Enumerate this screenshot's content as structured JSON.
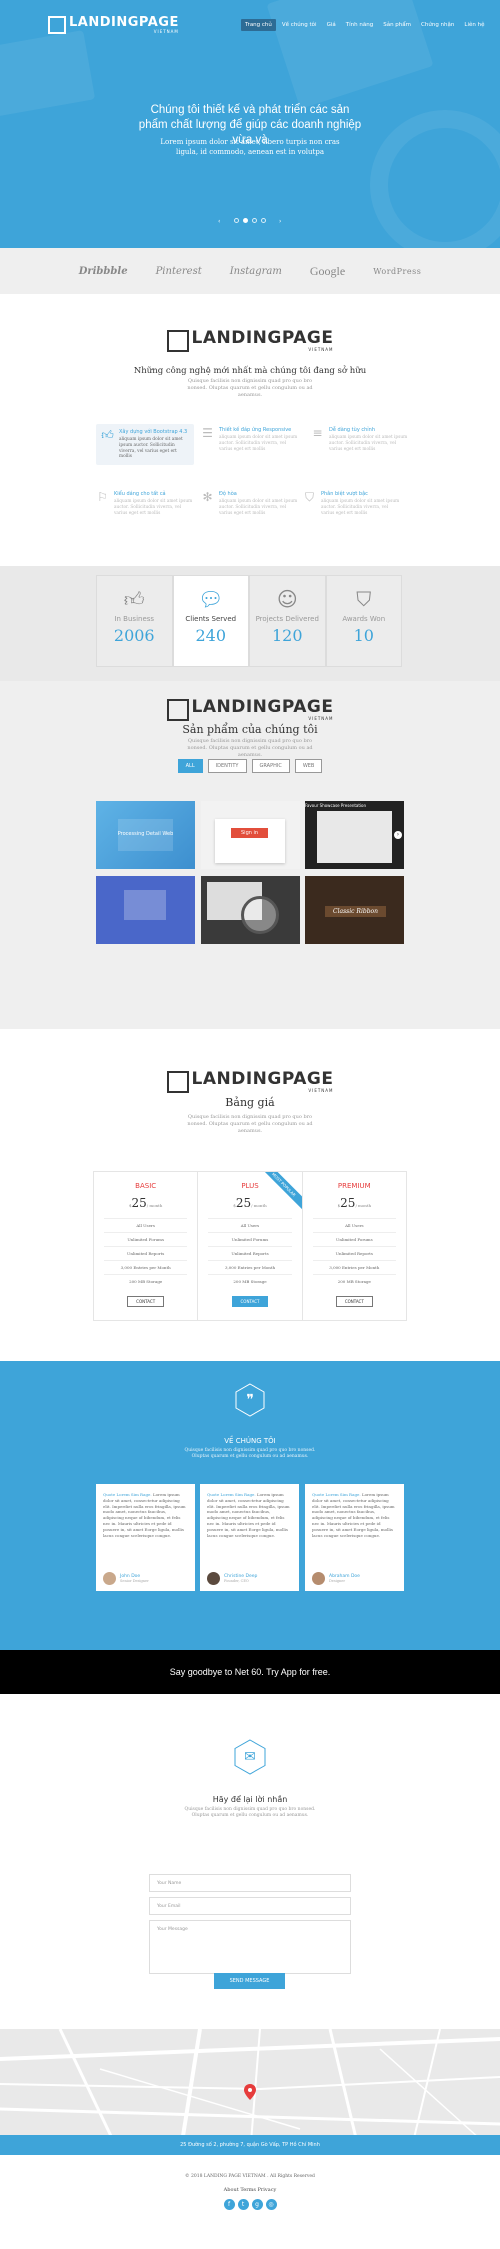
{
  "brand": {
    "name": "LANDINGPAGE",
    "sub": "VIETNAM"
  },
  "nav": {
    "items": [
      "Trang chủ",
      "Về chúng tôi",
      "Giá",
      "Tính năng",
      "Sản phẩm",
      "Chứng nhận",
      "Liên hệ"
    ],
    "active": 0
  },
  "hero": {
    "headline": "Chúng tôi thiết kế và phát triển các sản phẩm chất lượng để giúp các doanh nghiệp vừa và",
    "text": "Lorem ipsum dolor sit amet, libero turpis non cras ligula, id commodo, aenean est in volutpa",
    "slides": 4,
    "active_slide": 1
  },
  "partners": [
    "Dribbble",
    "Pinterest",
    "Instagram",
    "Google",
    "WordPress"
  ],
  "features": {
    "title": "Những công nghệ mới nhất mà chúng tôi đang sở hữu",
    "sub": "Quisque facilisis non dignissim quad pro quo bro nonsed. Oluptas quarum et gellu congulum ou ad aenamus.",
    "items": [
      {
        "icon": "thumbs-up-icon",
        "title": "Xây dựng với Bootstrap 4.3",
        "text": "aliquam ipsum dolor sit amet ipsum auctor. Sollicitudin viverra, vel varius eget ert mollis"
      },
      {
        "icon": "list-icon",
        "title": "Thiết kế đáp ứng Responsive",
        "text": "aliquam ipsum dolor sit amet ipsum auctor. Sollicitudin viverra, vel varius eget ert mollis"
      },
      {
        "icon": "lines-icon",
        "title": "Dễ dàng tùy chỉnh",
        "text": "aliquam ipsum dolor sit amet ipsum auctor. Sollicitudin viverra, vel varius eget ert mollis"
      },
      {
        "icon": "flag-icon",
        "title": "Kiểu dáng cho tất cả",
        "text": "aliquam ipsum dolor sit amet ipsum auctor. Sollicitudin viverra, vel varius eget ert mollis"
      },
      {
        "icon": "snowflake-icon",
        "title": "Độ hòa",
        "text": "aliquam ipsum dolor sit amet ipsum auctor. Sollicitudin viverra, vel varius eget ert mollis"
      },
      {
        "icon": "bookmark-icon",
        "title": "Phân biệt vượt bậc",
        "text": "aliquam ipsum dolor sit amet ipsum auctor. Sollicitudin viverra, vel varius eget ert mollis"
      }
    ]
  },
  "stats": [
    {
      "icon": "thumbs-up-icon",
      "label": "In Business",
      "value": "2006"
    },
    {
      "icon": "chat-icon",
      "label": "Clients Served",
      "value": "240"
    },
    {
      "icon": "smile-icon",
      "label": "Projects Delivered",
      "value": "120"
    },
    {
      "icon": "bookmark-icon",
      "label": "Awards Won",
      "value": "10"
    }
  ],
  "products": {
    "title": "Sản phẩm của chúng tôi",
    "sub": "Quisque facilisis non dignissim quad pro quo bro nonsed. Oluptas quarum et gellu congulum ou ad aenamus.",
    "filters": [
      "ALL",
      "IDENTITY",
      "GRAPHIC",
      "WEB"
    ],
    "active_filter": 0,
    "tiles": [
      "Processing Detail Web",
      "Sign in",
      "Favour Showcase Presentation",
      "",
      "",
      "Classic Ribbon"
    ]
  },
  "pricing": {
    "title": "Bảng giá",
    "sub": "Quisque facilisis non dignissim quad pro quo bro nonsed. Oluptas quarum et gellu congulum ou ad aenamus.",
    "ribbon": "MOST POPULAR",
    "plans": [
      {
        "name": "BASIC",
        "price": "25",
        "cur": "$",
        "per": "/ month",
        "features": [
          "All Users",
          "Unlimited Forums",
          "Unlimited Reports",
          "3,000 Entries per Month",
          "200 MB Storage"
        ],
        "button": "CONTACT"
      },
      {
        "name": "PLUS",
        "price": "25",
        "cur": "$",
        "per": "/ month",
        "features": [
          "All Users",
          "Unlimited Forums",
          "Unlimited Reports",
          "3,000 Entries per Month",
          "200 MB Storage"
        ],
        "button": "CONTACT"
      },
      {
        "name": "PREMIUM",
        "price": "25",
        "cur": "$",
        "per": "/ month",
        "features": [
          "All Users",
          "Unlimited Forums",
          "Unlimited Reports",
          "3,000 Entries per Month",
          "200 MB Storage"
        ],
        "button": "CONTACT"
      }
    ]
  },
  "about": {
    "title": "VỀ CHÚNG TÔI",
    "sub": "Quisque facilisis non dignissim quad pro quo bro nonsed. Oluptas quarum et gellu congulum ou ad aenamus.",
    "testimonials": [
      {
        "lead": "Quote Lorem Sim Rage.",
        "text": "Lorem ipsum dolor sit amet, consectetur adipiscing elit. Imperdiet nulla eros fringilla, ipsum modo amet, nonectus faucibus, adipiscing neque of bibendum, et felis nec in. Mauris ultricies et pede id posuere in, sit amet Eorge ligula, mollis lacus congue scelerisque congue.",
        "name": "John Doe",
        "role": "Senior Designer"
      },
      {
        "lead": "Quote Lorem Sim Rage.",
        "text": "Lorem ipsum dolor sit amet, consectetur adipiscing elit. Imperdiet nulla eros fringilla, ipsum modo amet, nonectus faucibus, adipiscing neque of bibendum, et felis nec in. Mauris ultricies et pede id posuere in, sit amet Eorge ligula, mollis lacus congue scelerisque congue.",
        "name": "Christine Deep",
        "role": "Founder, CEO"
      },
      {
        "lead": "Quote Lorem Sim Rage.",
        "text": "Lorem ipsum dolor sit amet, consectetur adipiscing elit. Imperdiet nulla eros fringilla, ipsum modo amet, nonectus faucibus, adipiscing neque of bibendum, et felis nec in. Mauris ultricies et pede id posuere in, sit amet Eorge ligula, mollis lacus congue scelerisque congue.",
        "name": "Abraham Doe",
        "role": "Designer"
      }
    ]
  },
  "cta": {
    "text": "Say goodbye to Net 60. Try App for free."
  },
  "contact": {
    "title": "Hãy để lại lời nhắn",
    "sub": "Quisque facilisis non dignissim quad pro quo bro nonsed. Oluptas quarum et gellu congulum ou ad aenamus.",
    "name_placeholder": "Your Name",
    "email_placeholder": "Your Email",
    "message_placeholder": "Your Message",
    "button": "SEND MESSAGE"
  },
  "map": {
    "address": "25 Đường số 2, phường 7, quận Gò Vấp, TP Hồ Chí Minh"
  },
  "footer": {
    "copyright": "© 2018 LANDING PAGE VIETNAM . All Rights Reserved",
    "links": [
      "About",
      "Terms",
      "Privacy"
    ],
    "socials": [
      "facebook-icon",
      "twitter-icon",
      "google-plus-icon",
      "dribbble-icon"
    ]
  },
  "colors": {
    "accent": "#3ea4d9",
    "dark": "#000000",
    "light_bg": "#efefef"
  }
}
